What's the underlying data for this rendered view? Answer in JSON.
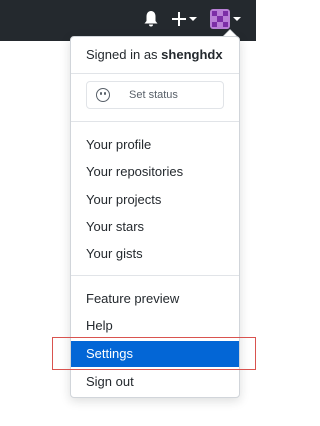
{
  "header": {
    "icons": [
      "bell-icon",
      "plus-icon",
      "avatar"
    ]
  },
  "dropdown": {
    "signed_in_prefix": "Signed in as ",
    "username": "shenghdx",
    "set_status_label": "Set status",
    "profile_items": [
      "Your profile",
      "Your repositories",
      "Your projects",
      "Your stars",
      "Your gists"
    ],
    "misc_items": [
      "Feature preview",
      "Help",
      "Settings",
      "Sign out"
    ],
    "active_item": "Settings"
  },
  "colors": {
    "topbar": "#24292e",
    "accent": "#0366d6",
    "highlight_box": "#d9534f"
  }
}
